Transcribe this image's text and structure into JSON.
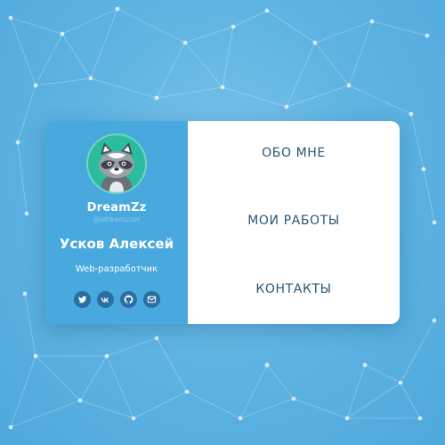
{
  "background": {
    "color": "#5fb4e2"
  },
  "profile": {
    "nickname": "DreamZz",
    "handle": "@idreamzzer",
    "full_name": "Усков Алексей",
    "role": "Web-разработчик",
    "avatar_icon": "raccoon-avatar",
    "panel_color": "#48a9df"
  },
  "socials": [
    {
      "icon": "twitter-icon"
    },
    {
      "icon": "vk-icon"
    },
    {
      "icon": "github-icon"
    },
    {
      "icon": "mail-icon"
    }
  ],
  "nav": {
    "about": "ОБО МНЕ",
    "works": "МОИ РАБОТЫ",
    "contacts": "КОНТАКТЫ"
  }
}
